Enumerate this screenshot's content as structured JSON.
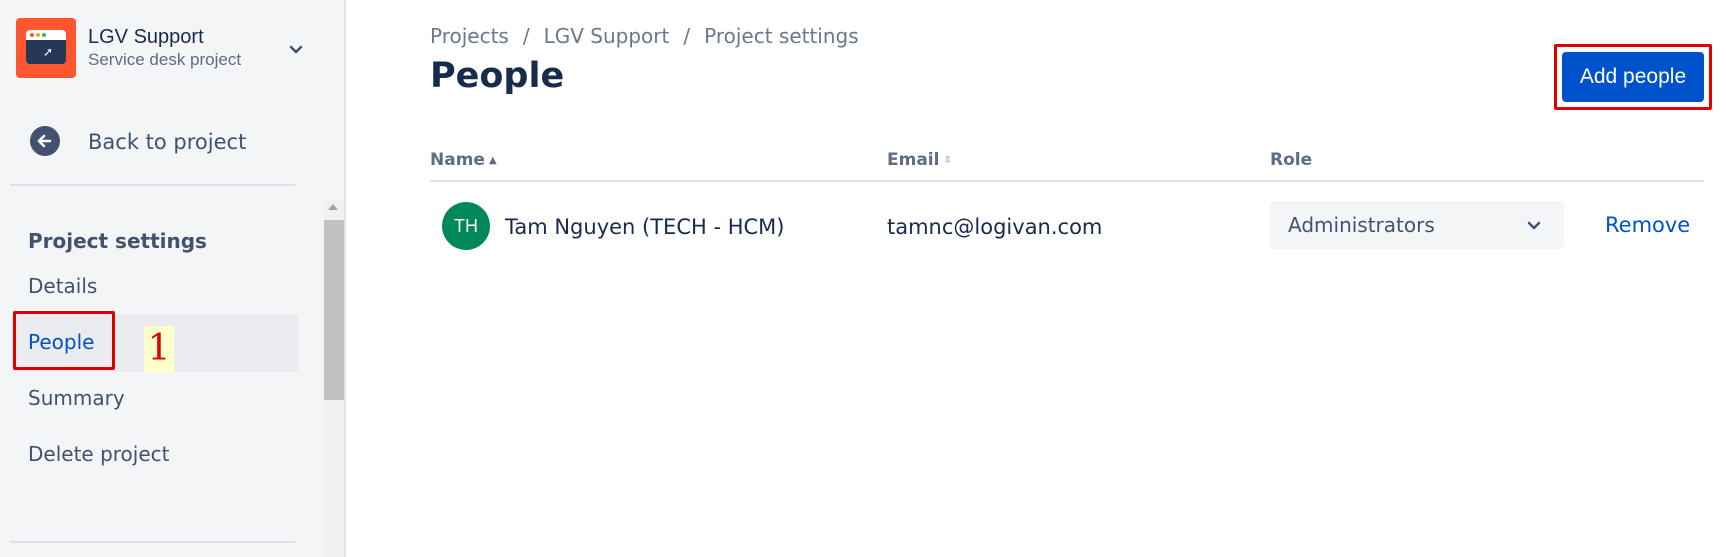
{
  "project": {
    "name": "LGV Support",
    "type": "Service desk project"
  },
  "sidebar": {
    "back_label": "Back to project",
    "section_title": "Project settings",
    "items": [
      {
        "label": "Details",
        "active": false
      },
      {
        "label": "People",
        "active": true
      },
      {
        "label": "Summary",
        "active": false
      },
      {
        "label": "Delete project",
        "active": false
      }
    ]
  },
  "annotation": {
    "step_number": "1"
  },
  "breadcrumb": {
    "items": [
      "Projects",
      "LGV Support",
      "Project settings"
    ],
    "separator": "/"
  },
  "page": {
    "title": "People",
    "add_button_label": "Add people"
  },
  "table": {
    "headers": {
      "name": "Name",
      "email": "Email",
      "role": "Role"
    },
    "rows": [
      {
        "initials": "TH",
        "name": "Tam Nguyen (TECH - HCM)",
        "email": "tamnc@logivan.com",
        "role": "Administrators",
        "action": "Remove"
      }
    ]
  },
  "colors": {
    "primary": "#0052cc",
    "avatar_bg": "#00875a",
    "project_icon_bg": "#ff5630",
    "annotation": "#e00000"
  },
  "icons": [
    "project-avatar-icon",
    "chevron-down-icon",
    "arrow-left-icon",
    "sort-ascending-icon",
    "sort-icon"
  ]
}
